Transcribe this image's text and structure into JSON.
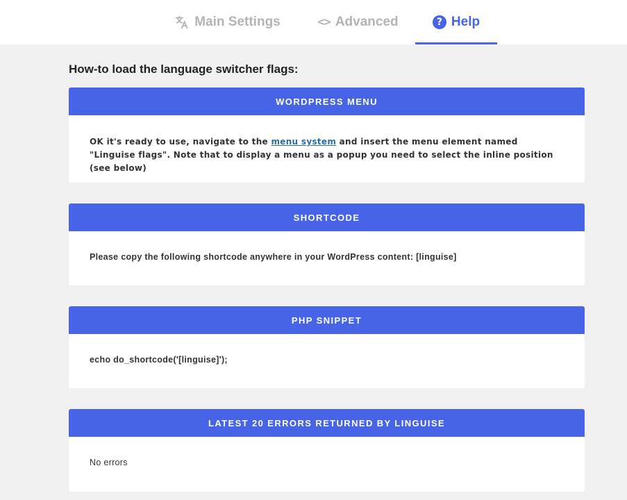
{
  "tabs": {
    "main_settings": "Main Settings",
    "advanced": "Advanced",
    "help": "Help",
    "active": "help",
    "accent_color": "#4764e6"
  },
  "heading": "How-to load the language switcher flags:",
  "sections": {
    "wordpress_menu": {
      "title": "WORDPRESS MENU",
      "text_before": "OK it's ready to use, navigate to the ",
      "link_text": "menu system",
      "text_after": " and insert the menu element named \"Linguise flags\". Note that to display a menu as a popup you need to select the inline position (see below)"
    },
    "shortcode": {
      "title": "SHORTCODE",
      "text": "Please copy the following shortcode anywhere in your WordPress content: [linguise]"
    },
    "php_snippet": {
      "title": "PHP SNIPPET",
      "text": "echo do_shortcode('[linguise]');"
    },
    "errors": {
      "title": "LATEST 20 ERRORS RETURNED BY LINGUISE",
      "text": "No errors"
    }
  },
  "icons": {
    "main_settings": "translate-icon",
    "advanced": "code-icon",
    "help": "help-circle-icon"
  }
}
